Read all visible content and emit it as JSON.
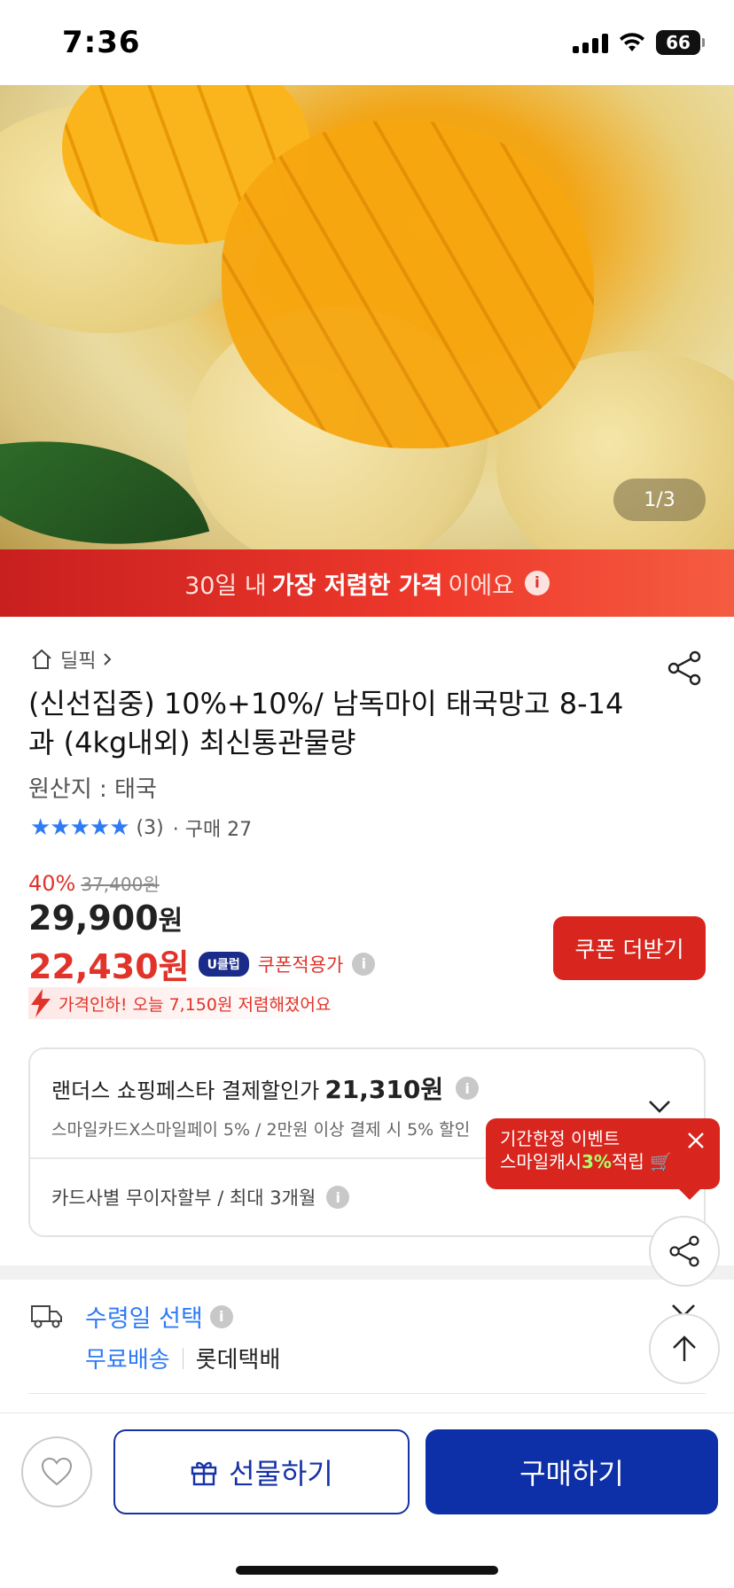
{
  "status_bar": {
    "time": "7:36",
    "battery": "66"
  },
  "gallery": {
    "counter": "1/3"
  },
  "banner": {
    "prefix": "30일 내 ",
    "highlight": "가장 저렴한 가격",
    "suffix": "이에요"
  },
  "product": {
    "breadcrumb": "딜픽",
    "title": "(신선집중) 10%+10%/ 남독마이 태국망고 8-14과 (4kg내외) 최신통관물량",
    "origin": "원산지 : 태국",
    "rating_stars": 5,
    "review_count": "(3)",
    "purchase_count": "· 구매 27"
  },
  "pricing": {
    "discount": "40%",
    "original": "37,400원",
    "sale_price": "29,900",
    "sale_unit": "원",
    "coupon_price": "22,430원",
    "uclub_badge": "U클럽",
    "coupon_label": "쿠폰적용가",
    "price_drop": "가격인하! 오늘 7,150원 저렴해졌어요",
    "coupon_button": "쿠폰 더받기"
  },
  "card_benefit": {
    "title": "랜더스 쇼핑페스타 결제할인가",
    "price": "21,310원",
    "subtitle": "스마일카드X스마일페이 5% / 2만원 이상 결제 시 5% 할인",
    "installment": "카드사별 무이자할부 / 최대 3개월"
  },
  "tooltip": {
    "line1": "기간한정 이벤트",
    "line2_prefix": "스마일캐시",
    "line2_pct": "3%",
    "line2_suffix": "적립 🛒"
  },
  "delivery": {
    "title": "수령일 선택",
    "shipping": "무료배송",
    "carrier": "롯데택배"
  },
  "bottom_bar": {
    "gift_label": "선물하기",
    "buy_label": "구매하기"
  },
  "colors": {
    "accent_red": "#d8261e",
    "accent_blue": "#0d2fa8",
    "link_blue": "#2f7bf5"
  }
}
